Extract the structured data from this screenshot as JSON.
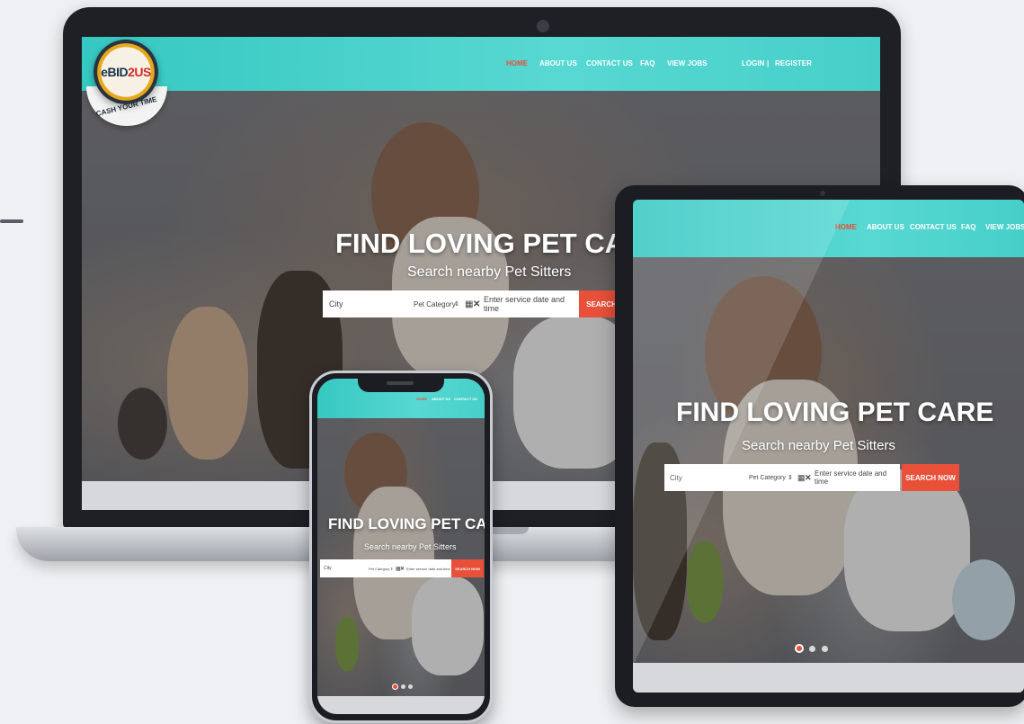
{
  "brand": {
    "logo_name": "eBID",
    "logo_accent": "2US",
    "tagline": "CASH YOUR TIME"
  },
  "nav": {
    "items": [
      "HOME",
      "ABOUT US",
      "CONTACT US",
      "FAQ",
      "VIEW JOBS"
    ],
    "active": "HOME",
    "login": "LOGIN",
    "separator": "|",
    "register": "REGISTER"
  },
  "hero": {
    "title": "FIND LOVING PET CARE",
    "subtitle": "Search nearby Pet Sitters"
  },
  "search": {
    "city_placeholder": "City",
    "category_label": "Pet Category",
    "category_arrow": "⇕",
    "date_placeholder": "Enter service date and time",
    "button": "SEARCH NOW",
    "button_cropped": "SEARCH"
  },
  "carousel": {
    "slides": 3,
    "active_index": 0
  },
  "colors": {
    "navbar": "#46cfc9",
    "accent": "#e8503a",
    "frame": "#1e2026"
  },
  "icons": {
    "calendar": "calendar-icon",
    "clear": "clear-icon"
  }
}
